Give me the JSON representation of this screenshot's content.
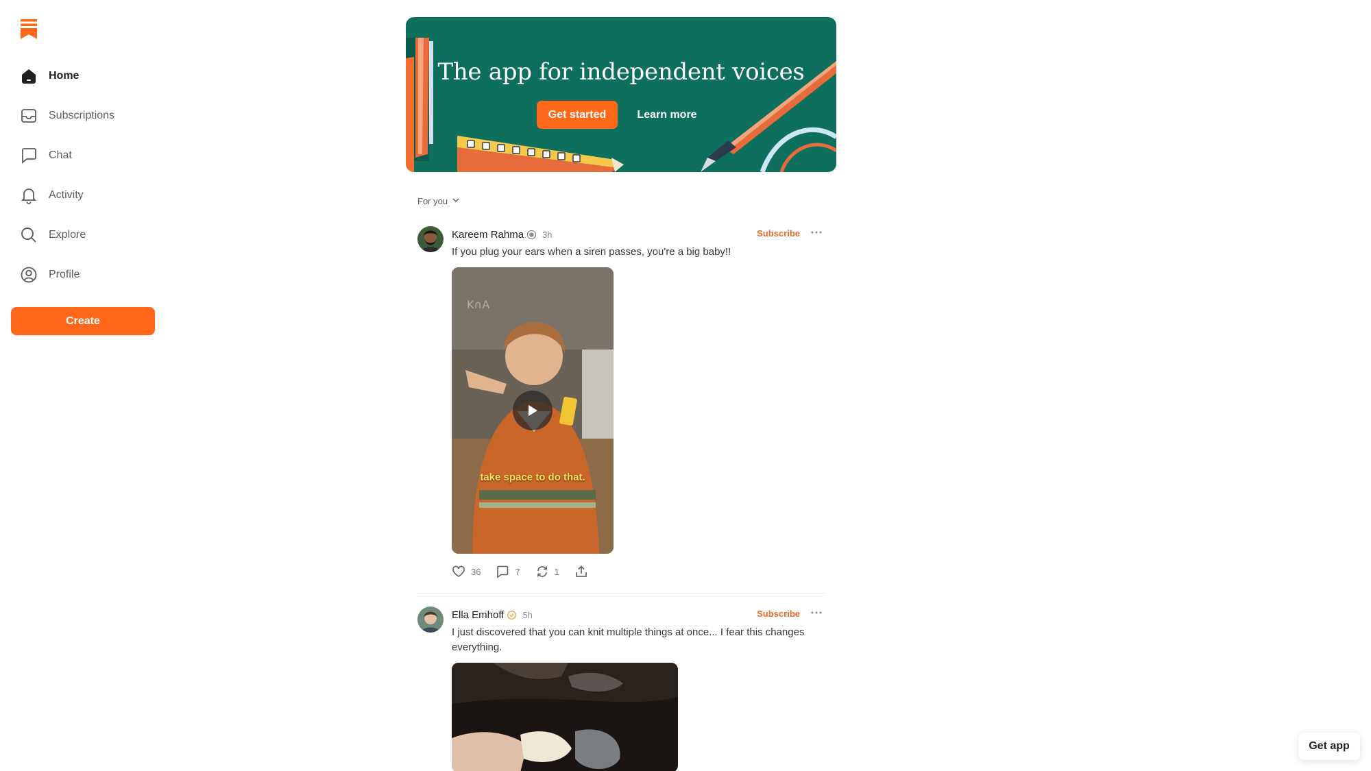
{
  "colors": {
    "accent": "#ff6719",
    "banner_bg": "#0f6f5d",
    "subscribe": "#e9692c"
  },
  "sidebar": {
    "logo_icon": "substack-logo-icon",
    "items": [
      {
        "label": "Home",
        "icon": "home-icon",
        "active": true
      },
      {
        "label": "Subscriptions",
        "icon": "inbox-icon",
        "active": false
      },
      {
        "label": "Chat",
        "icon": "chat-bubble-icon",
        "active": false
      },
      {
        "label": "Activity",
        "icon": "bell-icon",
        "active": false
      },
      {
        "label": "Explore",
        "icon": "search-icon",
        "active": false
      },
      {
        "label": "Profile",
        "icon": "profile-icon",
        "active": false
      }
    ],
    "create_label": "Create"
  },
  "banner": {
    "title": "The app for independent voices",
    "primary_label": "Get started",
    "secondary_label": "Learn more"
  },
  "feed": {
    "filter_label": "For you",
    "posts": [
      {
        "author": "Kareem Rahma",
        "verified_icon": "verified-badge-icon",
        "time": "3h",
        "subscribe_label": "Subscribe",
        "text": "If you plug your ears when a siren passes, you're a big baby!!",
        "media_type": "video",
        "video_caption": "take space to do that.",
        "likes": "36",
        "comments": "7",
        "restacks": "1"
      },
      {
        "author": "Ella Emhoff",
        "verified_icon": "verified-badge-icon",
        "time": "5h",
        "subscribe_label": "Subscribe",
        "text": "I just discovered that you can knit multiple things at once... I fear this changes everything.",
        "media_type": "image"
      }
    ]
  },
  "get_app_label": "Get app"
}
